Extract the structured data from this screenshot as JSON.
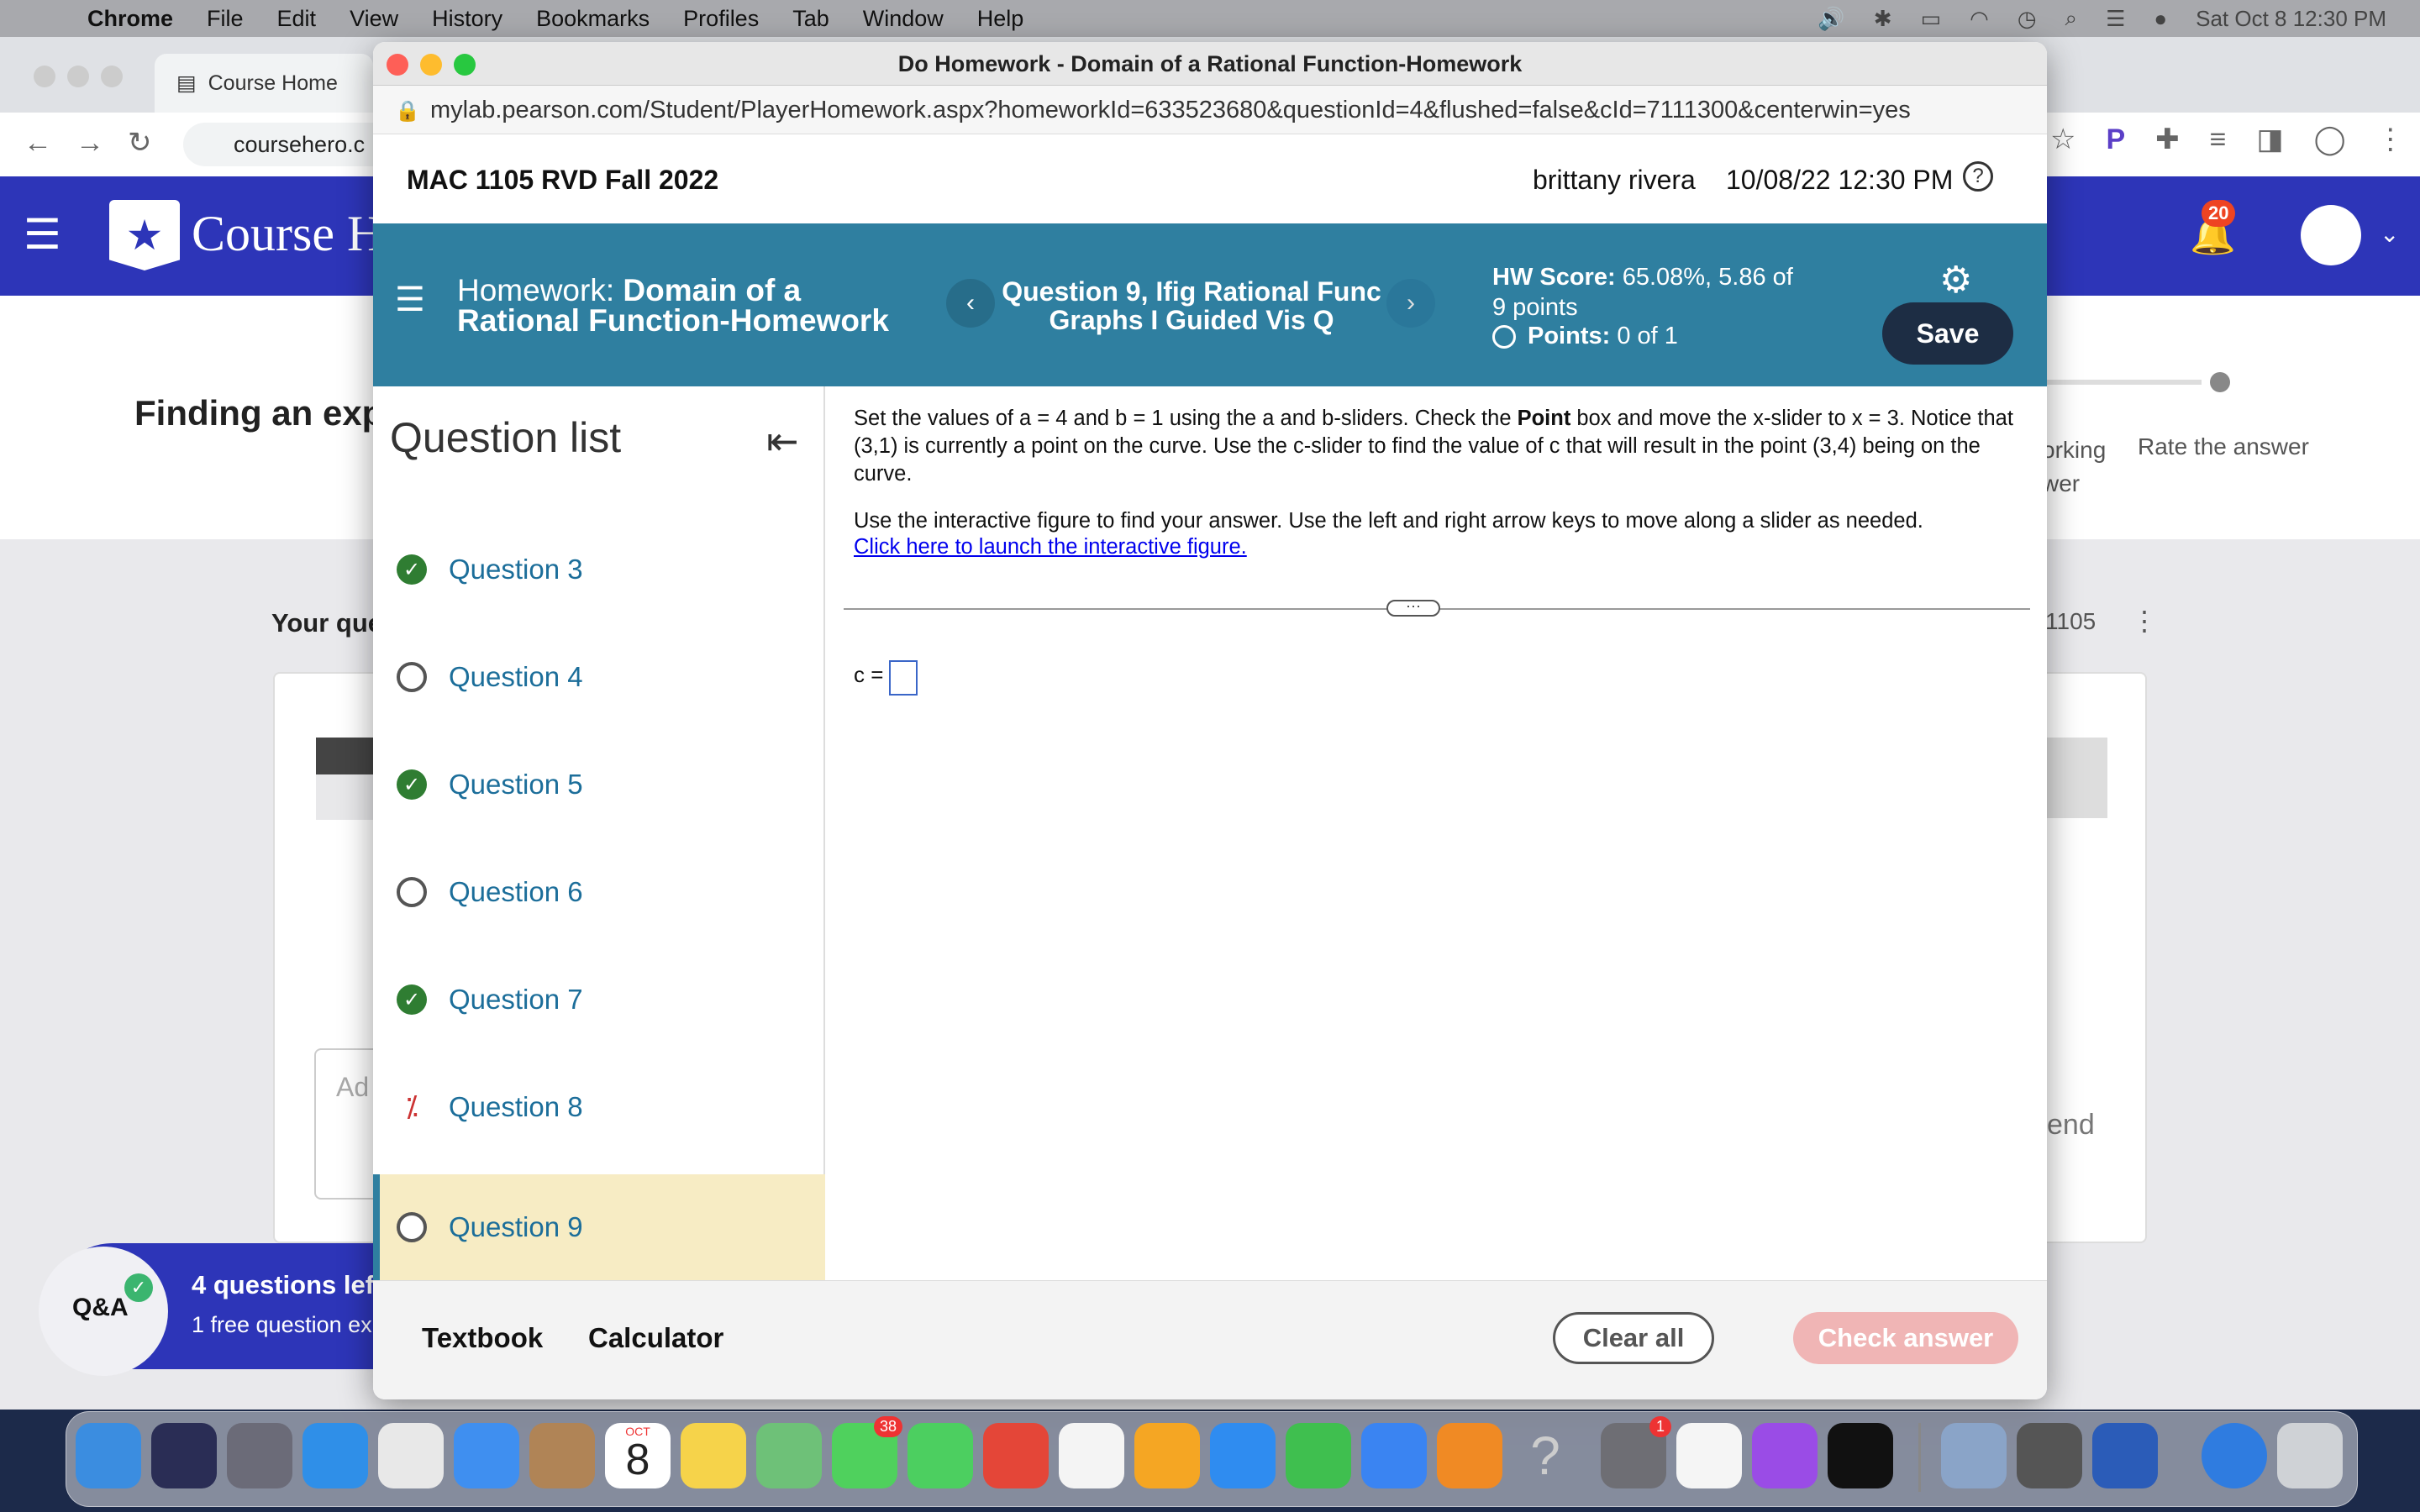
{
  "menubar": {
    "app": "Chrome",
    "items": [
      "File",
      "Edit",
      "View",
      "History",
      "Bookmarks",
      "Profiles",
      "Tab",
      "Window",
      "Help"
    ],
    "clock": "Sat Oct 8  12:30 PM"
  },
  "bg_browser": {
    "tab_title": "Course Home",
    "url": "coursehero.c",
    "site_name": "Course H",
    "notification_count": "20",
    "page_heading": "Finding an exp",
    "your_question": "Your que",
    "working_text_1": "orking",
    "working_text_2": "wer",
    "rate_answer": "Rate the answer",
    "course_code": "1105",
    "ad_text": "Ad",
    "end_text": "end",
    "qa_label": "Q&A",
    "qa_line1": "4 questions left",
    "qa_line2": "1 free question ex"
  },
  "window": {
    "title": "Do Homework - Domain of a Rational Function-Homework",
    "url": "mylab.pearson.com/Student/PlayerHomework.aspx?homeworkId=633523680&questionId=4&flushed=false&cId=7111300&centerwin=yes",
    "course": "MAC 1105 RVD Fall 2022",
    "user": "brittany rivera",
    "datetime": "10/08/22 12:30 PM",
    "help": "?"
  },
  "header": {
    "hw_prefix": "Homework: ",
    "hw_name": "Domain of a Rational Function-Homework",
    "question_title": "Question 9, Ifig Rational Func Graphs I Guided Vis Q",
    "hw_score_label": "HW Score:",
    "hw_score_value": " 65.08%, 5.86 of 9 points",
    "points_label": "Points:",
    "points_value": " 0 of 1",
    "save": "Save",
    "prev": "‹",
    "next": "›"
  },
  "question_list": {
    "title": "Question list",
    "items": [
      {
        "label": "Question 3",
        "status": "correct"
      },
      {
        "label": "Question 4",
        "status": "open"
      },
      {
        "label": "Question 5",
        "status": "correct"
      },
      {
        "label": "Question 6",
        "status": "open"
      },
      {
        "label": "Question 7",
        "status": "correct"
      },
      {
        "label": "Question 8",
        "status": "partial"
      },
      {
        "label": "Question 9",
        "status": "open",
        "current": true
      }
    ]
  },
  "question": {
    "text_pre": "Set the values of a = 4 and b = 1 using the a and b-sliders. Check the ",
    "text_bold": "Point",
    "text_post": " box and move the x-slider to x = 3. Notice that (3,1) is currently a point on the curve. Use the c-slider to find the value of c that will result in the point (3,4) being on the curve.",
    "instruction": "Use the interactive figure to find your answer. Use the left and right arrow keys to move along a slider as needed.",
    "link": "Click here to launch the interactive figure.",
    "answer_label": "c =",
    "answer_value": ""
  },
  "footer": {
    "textbook": "Textbook",
    "calculator": "Calculator",
    "clear_all": "Clear all",
    "check_answer": "Check answer"
  },
  "dock": {
    "calendar_month": "OCT",
    "calendar_day": "8",
    "messages_badge": "38",
    "settings_badge": "1"
  },
  "colors": {
    "teal_header": "#2f7fa0",
    "save_button": "#1d2d44",
    "coursehero_blue": "#2d35b8",
    "correct_green": "#2f7d32",
    "current_highlight": "#f7ecc4"
  }
}
